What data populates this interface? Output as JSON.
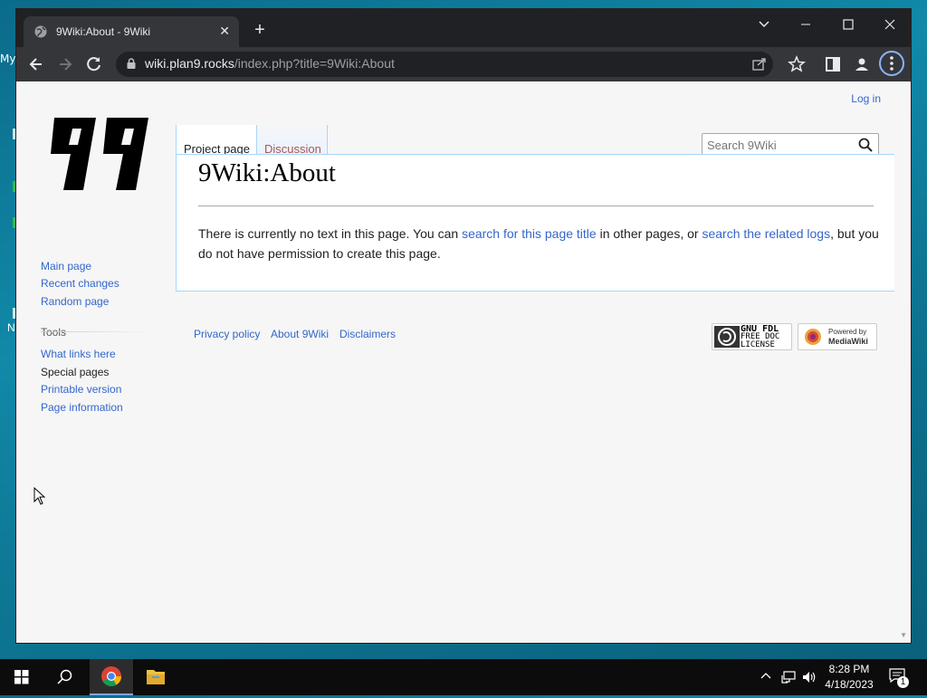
{
  "browser": {
    "tab_title": "9Wiki:About - 9Wiki",
    "url_host": "wiki.plan9.rocks",
    "url_path": "/index.php?title=9Wiki:About"
  },
  "wiki": {
    "login": "Log in",
    "sidebar": {
      "nav": [
        "Main page",
        "Recent changes",
        "Random page"
      ],
      "tools_heading": "Tools",
      "tools": [
        "What links here",
        "Special pages",
        "Printable version",
        "Page information"
      ]
    },
    "tabs": [
      "Project page",
      "Discussion"
    ],
    "search_placeholder": "Search 9Wiki",
    "title": "9Wiki:About",
    "body": {
      "part1": "There is currently no text in this page. You can ",
      "link1": "search for this page title",
      "part2": " in other pages, or ",
      "link2": "search the related logs",
      "part3": ", but you do not have permission to create this page."
    },
    "footer_links": [
      "Privacy policy",
      "About 9Wiki",
      "Disclaimers"
    ],
    "badges": {
      "gfdl": [
        "GNU FDL",
        "FREE DOC",
        "LICENSE"
      ],
      "mediawiki": [
        "Powered by",
        "MediaWiki"
      ]
    }
  },
  "desktop": {
    "label_top": "My",
    "label_mid": "N"
  },
  "taskbar": {
    "time": "8:28 PM",
    "date": "4/18/2023",
    "notification_count": "1"
  },
  "colors": {
    "link": "#3366cc",
    "chrome_dark": "#202124",
    "chrome_toolbar": "#35363a"
  }
}
